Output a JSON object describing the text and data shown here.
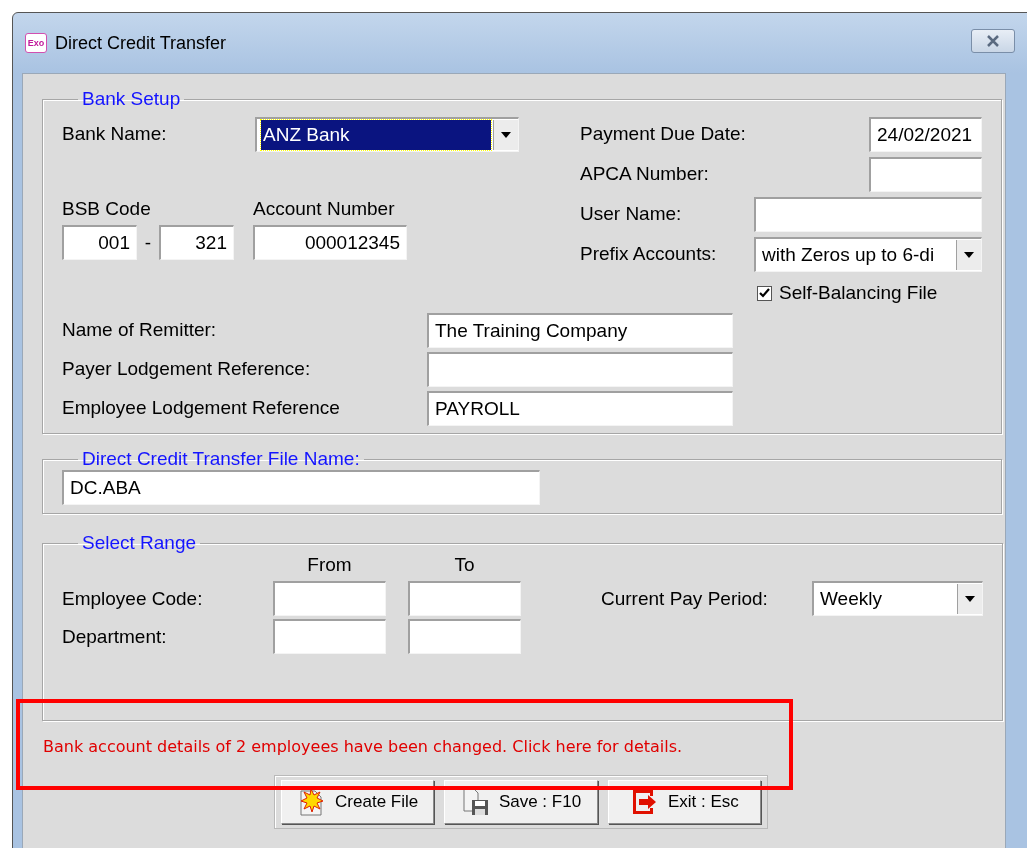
{
  "window": {
    "app_badge": "Exo",
    "title": "Direct Credit Transfer"
  },
  "bank_setup": {
    "title": "Bank Setup",
    "bank_name": {
      "label": "Bank Name:",
      "value": "ANZ Bank",
      "focused": true
    },
    "bsb": {
      "label": "BSB Code",
      "part_1": "001",
      "separator": "-",
      "part_2": "321"
    },
    "account_number": {
      "label": "Account Number",
      "value": "000012345"
    },
    "payment_due_date": {
      "label": "Payment Due Date:",
      "value": "24/02/2021"
    },
    "apca_number": {
      "label": "APCA Number:"
    },
    "user_name": {
      "label": "User Name:"
    },
    "prefix_accounts": {
      "label": "Prefix Accounts:",
      "value": "with Zeros up to 6-di"
    },
    "self_balancing": {
      "label": "Self-Balancing File",
      "checked": true
    },
    "remitter_fields": [
      {
        "label": "Name of Remitter:",
        "value": "The Training Company"
      },
      {
        "label": "Payer Lodgement Reference:"
      },
      {
        "label": "Employee Lodgement Reference",
        "value": "PAYROLL"
      }
    ]
  },
  "file_name": {
    "title": "Direct Credit Transfer File Name:",
    "value": "DC.ABA"
  },
  "select_range": {
    "title": "Select Range",
    "from_header": "From",
    "to_header": "To",
    "rows": [
      {
        "label": "Employee Code:"
      },
      {
        "label": "Department:"
      }
    ],
    "pay_period": {
      "label": "Current Pay Period:",
      "value": "Weekly"
    }
  },
  "notice": {
    "text": "Bank account details of 2 employees have been changed. Click here for details.",
    "highlighted": true
  },
  "buttons": [
    {
      "kind": "create",
      "label": "Create File"
    },
    {
      "kind": "save",
      "label": "Save : F10"
    },
    {
      "kind": "exit",
      "label": "Exit : Esc"
    }
  ]
}
